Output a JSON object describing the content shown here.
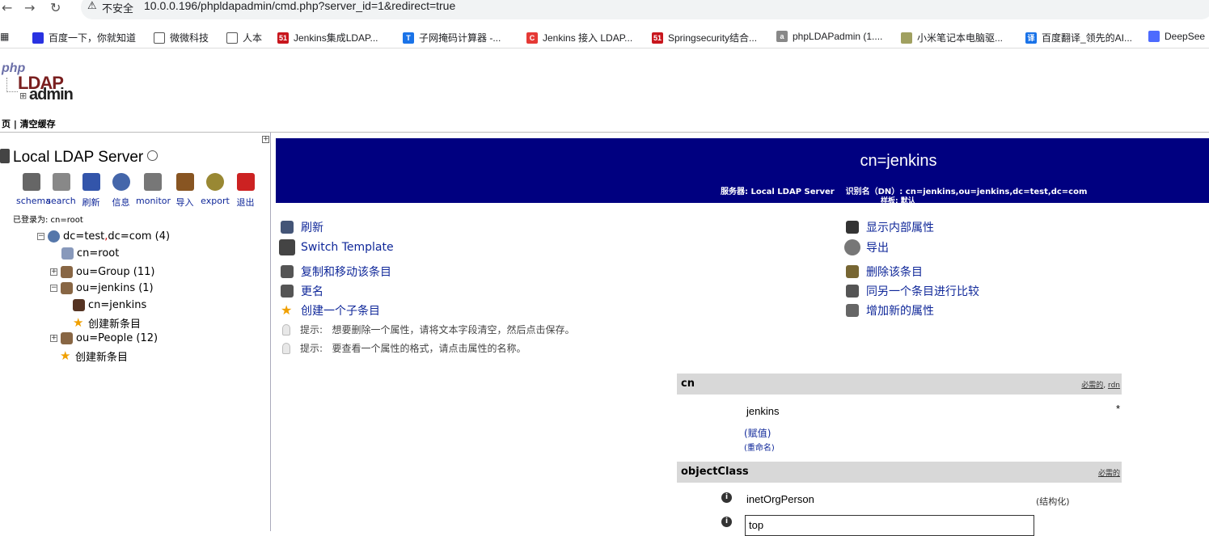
{
  "browser": {
    "security_label": "不安全",
    "url": "10.0.0.196/phpldapadmin/cmd.php?server_id=1&redirect=true",
    "bookmarks": [
      {
        "label": "百度一下，你就知道",
        "color": "#2932e1"
      },
      {
        "label": "微微科技",
        "color": "#555555"
      },
      {
        "label": "人本",
        "color": "#555555"
      },
      {
        "label": "Jenkins集成LDAP...",
        "color": "#c8161d"
      },
      {
        "label": "子网掩码计算器 -...",
        "color": "#1a73e8"
      },
      {
        "label": "Jenkins 接入 LDAP...",
        "color": "#e53935"
      },
      {
        "label": "Springsecurity结合...",
        "color": "#c8161d"
      },
      {
        "label": "phpLDAPadmin (1....",
        "color": "#888888"
      },
      {
        "label": "小米笔记本电脑驱...",
        "color": "#a0a060"
      },
      {
        "label": "百度翻译_领先的AI...",
        "color": "#1a73e8"
      },
      {
        "label": "DeepSee",
        "color": "#4d6bfe"
      }
    ]
  },
  "logo": {
    "php": "php",
    "ldap": "LDAP",
    "admin": "admin"
  },
  "toplinks": "页 | 清空缓存",
  "left": {
    "server_name": "Local LDAP Server",
    "tools": [
      {
        "label": "schema",
        "color": "#666666"
      },
      {
        "label": "search",
        "color": "#888888"
      },
      {
        "label": "刷新",
        "color": "#3355aa"
      },
      {
        "label": "信息",
        "color": "#4466aa"
      },
      {
        "label": "monitor",
        "color": "#777777"
      },
      {
        "label": "导入",
        "color": "#885522"
      },
      {
        "label": "export",
        "color": "#998833"
      },
      {
        "label": "退出",
        "color": "#cc2222"
      }
    ],
    "logged_in": "已登录为: cn=root",
    "tree": {
      "root": {
        "attr": "dc",
        "value1": "test",
        "comma": ",",
        "attr2": "dc",
        "value2": "com",
        "count": "(4)"
      },
      "cn_root": "cn=root",
      "ou_group": "ou=Group (11)",
      "ou_jenkins": "ou=jenkins (1)",
      "cn_jenkins": "cn=jenkins",
      "create_child_1": "创建新条目",
      "ou_people": "ou=People (12)",
      "create_child_2": "创建新条目"
    }
  },
  "banner": {
    "title": "cn=jenkins",
    "server_label": "服务器:",
    "server_value": "Local LDAP Server",
    "dn_label": "识别名（DN）:",
    "dn_value": "cn=jenkins,ou=jenkins,dc=test,dc=com",
    "template_label": "样板:",
    "template_value": "默认"
  },
  "actions_left": [
    {
      "label": "刷新",
      "color": "#445577"
    },
    {
      "label": "Switch Template",
      "color": "#444444"
    },
    {
      "label": "复制和移动该条目",
      "color": "#555555"
    },
    {
      "label": "更名",
      "color": "#555555"
    },
    {
      "label": "创建一个子条目",
      "color": "#f0a000"
    }
  ],
  "actions_right": [
    {
      "label": "显示内部属性",
      "color": "#333333"
    },
    {
      "label": "导出",
      "color": "#777777"
    },
    {
      "label": "删除该条目",
      "color": "#776633"
    },
    {
      "label": "同另一个条目进行比较",
      "color": "#555555"
    },
    {
      "label": "增加新的属性",
      "color": "#666666"
    }
  ],
  "hints": [
    {
      "label": "提示:",
      "text": "想要删除一个属性，请将文本字段清空，然后点击保存。"
    },
    {
      "label": "提示:",
      "text": "要查看一个属性的格式，请点击属性的名称。"
    }
  ],
  "attributes": {
    "cn": {
      "name": "cn",
      "meta_required": "必需的",
      "meta_rdn": "rdn",
      "value": "jenkins",
      "required_star": "*",
      "assign_link": "赋值",
      "rename_link": "重命名"
    },
    "objectClass": {
      "name": "objectClass",
      "meta_required": "必需的",
      "value1": "inetOrgPerson",
      "structural": "(结构化)",
      "value2": "top"
    }
  }
}
